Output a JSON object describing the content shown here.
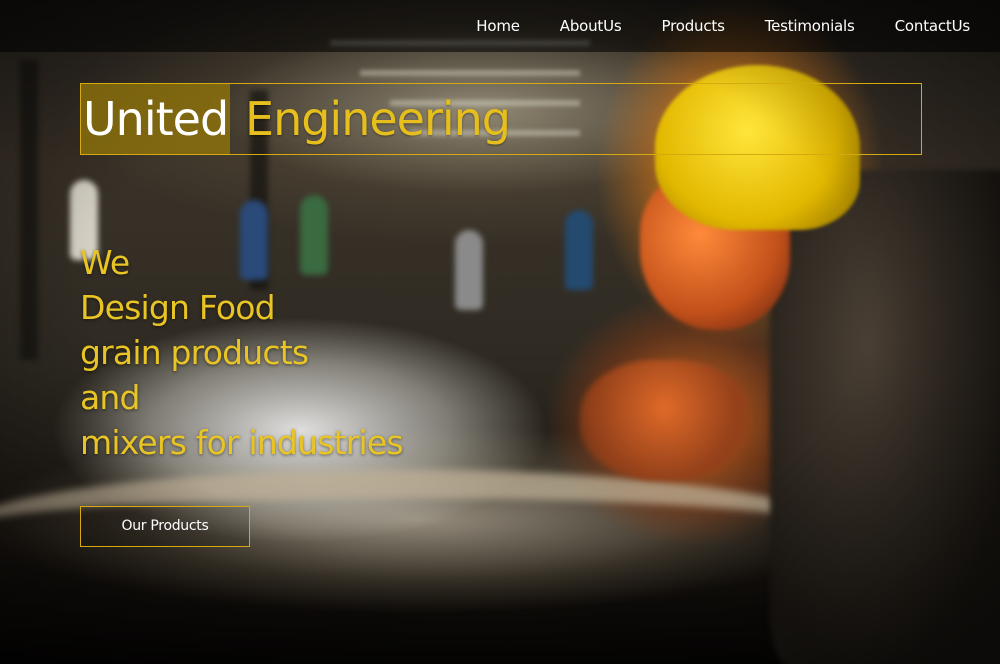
{
  "nav": {
    "items": [
      {
        "label": "Home"
      },
      {
        "label": "AboutUs"
      },
      {
        "label": "Products"
      },
      {
        "label": "Testimonials"
      },
      {
        "label": "ContactUs"
      }
    ]
  },
  "brand": {
    "first": "United",
    "second": "Engineering"
  },
  "tagline": {
    "lines": [
      "We",
      "Design Food",
      "grain products",
      "and",
      "mixers for industries"
    ]
  },
  "cta": {
    "label": "Our Products"
  },
  "colors": {
    "accent": "#e8c424",
    "brand_highlight_bg": "#96780a",
    "border": "#d4aa10",
    "nav_text": "#ffffff"
  },
  "background": {
    "icon": "welder-photo"
  }
}
